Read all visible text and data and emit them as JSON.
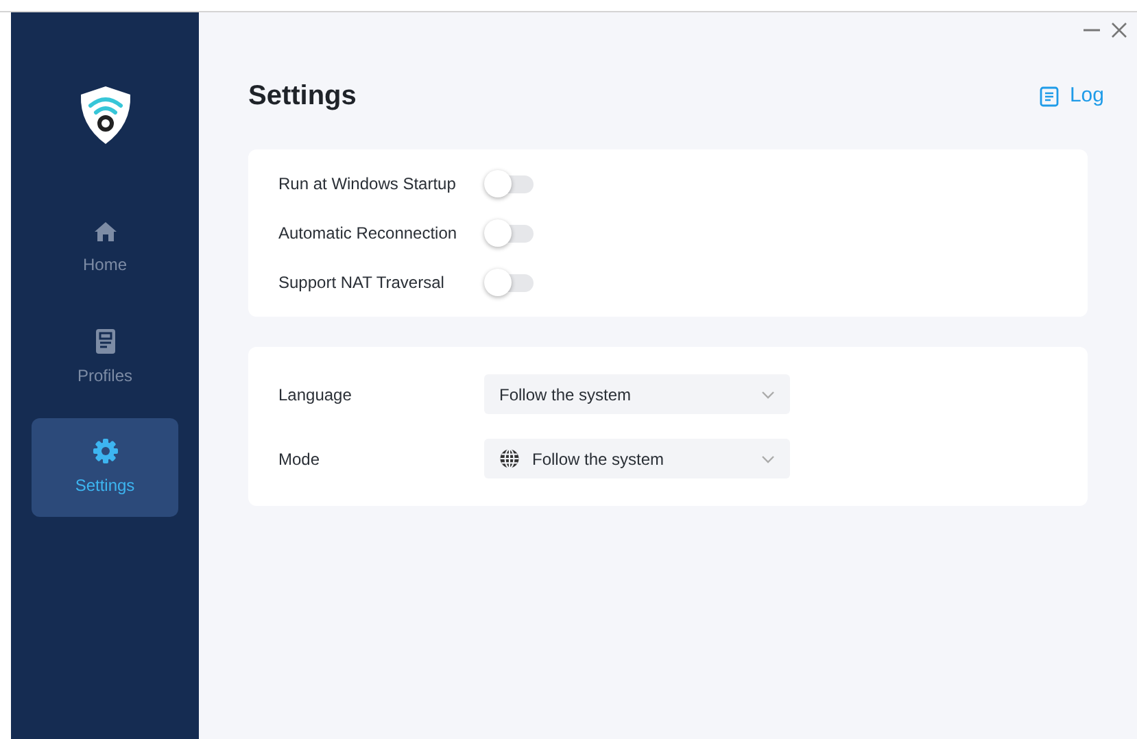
{
  "window": {
    "controls": [
      {
        "kind": "minimize"
      },
      {
        "kind": "close"
      }
    ]
  },
  "sidebar": {
    "items": [
      {
        "label": "Home",
        "kind": "home",
        "selected": false
      },
      {
        "label": "Profiles",
        "kind": "profile",
        "selected": false
      },
      {
        "label": "Settings",
        "kind": "gear",
        "selected": true
      }
    ]
  },
  "header": {
    "title": "Settings",
    "log_link": "Log"
  },
  "toggles": [
    {
      "label": "Run at Windows Startup",
      "on": false
    },
    {
      "label": "Automatic Reconnection",
      "on": false
    },
    {
      "label": "Support NAT Traversal",
      "on": false
    }
  ],
  "selects": [
    {
      "label": "Language",
      "value": "Follow the system",
      "kind": "plain"
    },
    {
      "label": "Mode",
      "value": "Follow the system",
      "kind": "globe"
    }
  ]
}
